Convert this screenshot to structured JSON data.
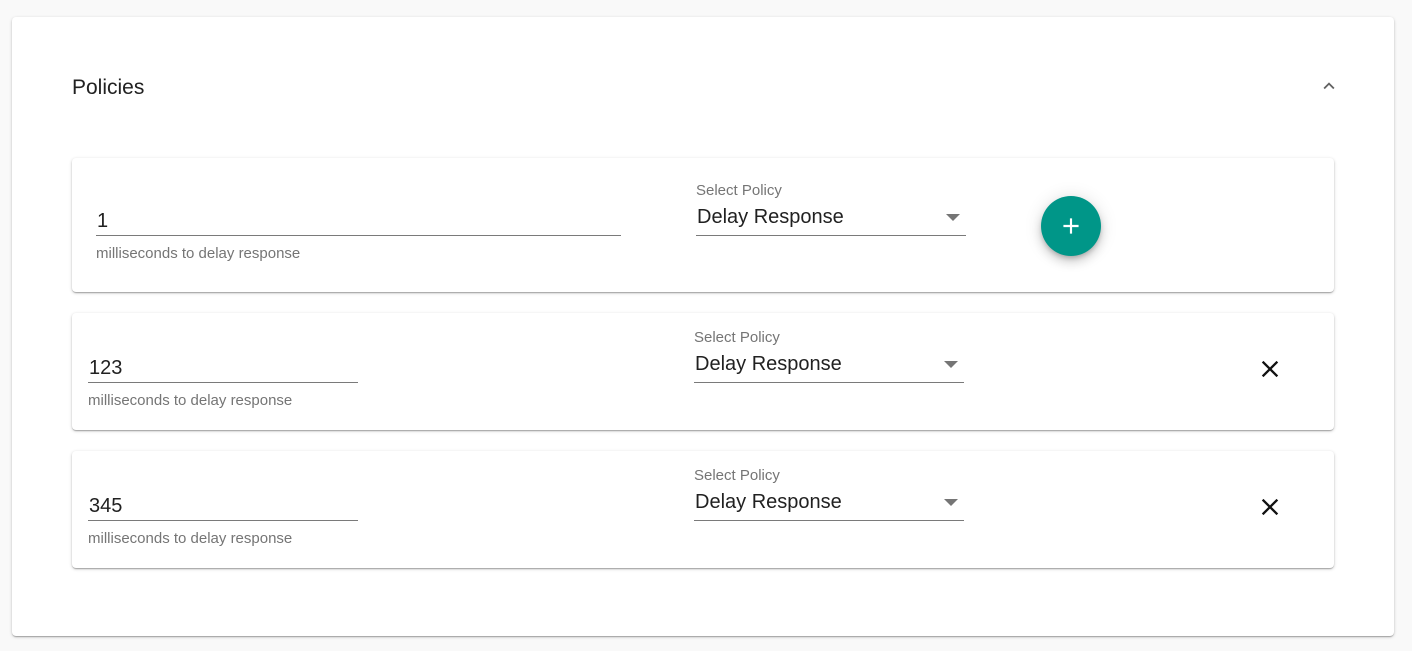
{
  "panel": {
    "title": "Policies",
    "collapse_icon": "chevron-up-icon"
  },
  "policies": [
    {
      "delay_value": "1",
      "delay_helper": "milliseconds to delay response",
      "select_label": "Select Policy",
      "select_value": "Delay Response",
      "action": "add",
      "action_icon": "plus-icon"
    },
    {
      "delay_value": "123",
      "delay_helper": "milliseconds to delay response",
      "select_label": "Select Policy",
      "select_value": "Delay Response",
      "action": "remove",
      "action_icon": "close-icon"
    },
    {
      "delay_value": "345",
      "delay_helper": "milliseconds to delay response",
      "select_label": "Select Policy",
      "select_value": "Delay Response",
      "action": "remove",
      "action_icon": "close-icon"
    }
  ],
  "colors": {
    "accent": "#009688",
    "panel_background": "#ffffff",
    "page_background": "#f9f9f9"
  }
}
